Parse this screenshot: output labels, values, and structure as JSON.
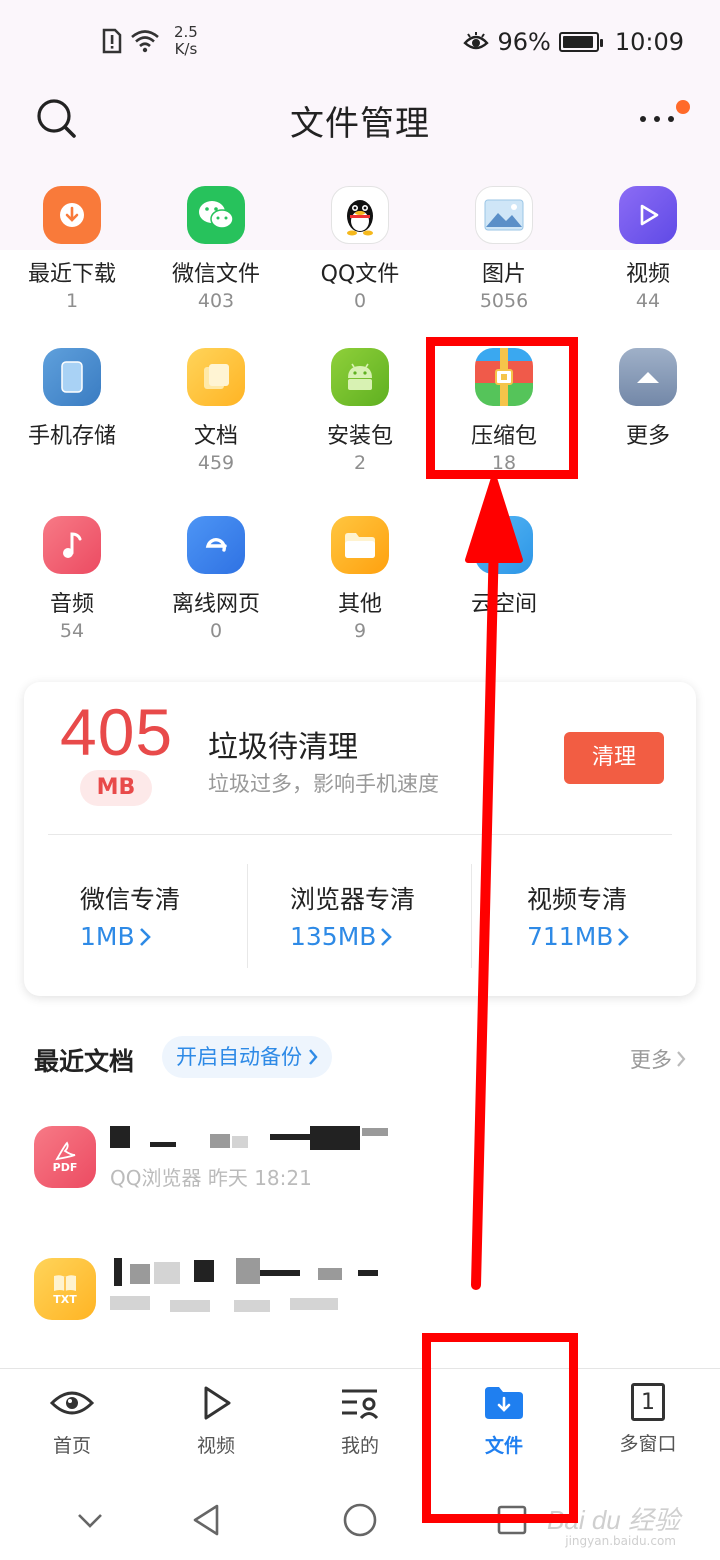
{
  "status_bar": {
    "net_speed_value": "2.5",
    "net_speed_unit": "K/s",
    "battery": "96%",
    "time": "10:09"
  },
  "header": {
    "title": "文件管理"
  },
  "categories": [
    {
      "label": "最近下载",
      "count": "1",
      "icon": "download-icon",
      "color": "#f97a3a"
    },
    {
      "label": "微信文件",
      "count": "403",
      "icon": "wechat-icon",
      "color": "#27c25c"
    },
    {
      "label": "QQ文件",
      "count": "0",
      "icon": "qq-penguin-icon",
      "color": "#ffffff"
    },
    {
      "label": "图片",
      "count": "5056",
      "icon": "image-icon",
      "color": "#ffffff"
    },
    {
      "label": "视频",
      "count": "44",
      "icon": "video-play-icon",
      "color": "#7a5cf2"
    },
    {
      "label": "手机存储",
      "count": "",
      "icon": "phone-storage-icon",
      "color": "#4a8fd4"
    },
    {
      "label": "文档",
      "count": "459",
      "icon": "document-icon",
      "color": "#ffc437"
    },
    {
      "label": "安装包",
      "count": "2",
      "icon": "android-icon",
      "color": "#7cc22e"
    },
    {
      "label": "压缩包",
      "count": "18",
      "icon": "zip-icon",
      "color": "#f05a4a"
    },
    {
      "label": "更多",
      "count": "",
      "icon": "expand-up-icon",
      "color": "#8da0bd"
    },
    {
      "label": "音频",
      "count": "54",
      "icon": "music-note-icon",
      "color": "#f25a6e"
    },
    {
      "label": "离线网页",
      "count": "0",
      "icon": "browser-e-icon",
      "color": "#3a86f0"
    },
    {
      "label": "其他",
      "count": "9",
      "icon": "folder-icon",
      "color": "#ffb31f"
    },
    {
      "label": "云空间",
      "count": "",
      "icon": "cloud-icon",
      "color": "#3aa8f0"
    }
  ],
  "cleanup": {
    "size_value": "405",
    "size_unit": "MB",
    "title": "垃圾待清理",
    "subtitle": "垃圾过多，影响手机速度",
    "button": "清理",
    "items": [
      {
        "label": "微信专清",
        "value": "1MB"
      },
      {
        "label": "浏览器专清",
        "value": "135MB"
      },
      {
        "label": "视频专清",
        "value": "711MB"
      }
    ]
  },
  "recent": {
    "title": "最近文档",
    "backup_label": "开启自动备份",
    "more_label": "更多",
    "docs": [
      {
        "type_label": "PDF",
        "meta": "QQ浏览器 昨天 18:21",
        "color": "#f0566b"
      },
      {
        "type_label": "TXT",
        "meta": "",
        "color": "#ffc437"
      }
    ]
  },
  "bottom_nav": [
    {
      "label": "首页",
      "icon": "eye-icon"
    },
    {
      "label": "视频",
      "icon": "play-outline-icon"
    },
    {
      "label": "我的",
      "icon": "profile-list-icon"
    },
    {
      "label": "文件",
      "icon": "file-folder-icon",
      "active": true
    },
    {
      "label": "多窗口",
      "icon": "multi-window-icon",
      "count": "1"
    }
  ],
  "watermark": {
    "text": "Bai du 经验",
    "sub": "jingyan.baidu.com"
  },
  "colors": {
    "accent": "#1f7ff0",
    "danger": "#e84a4a",
    "annotation": "#ff0000"
  }
}
